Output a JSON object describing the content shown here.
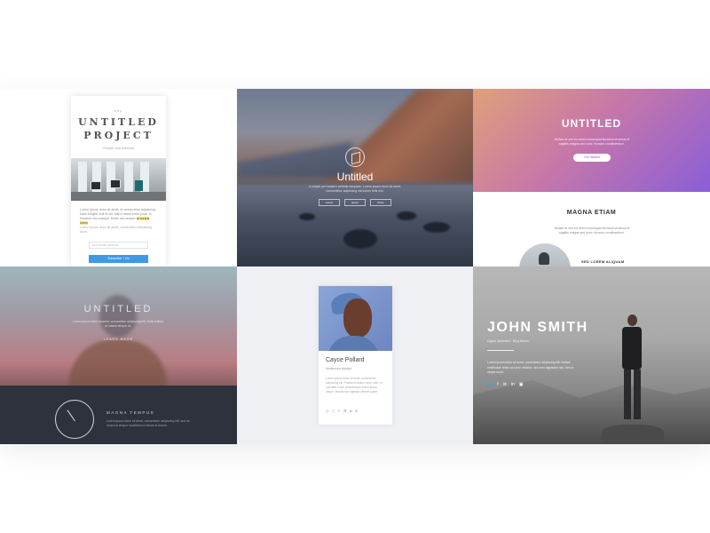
{
  "tiles": {
    "untitled_project": {
      "kicker": "hey",
      "title_line1": "UNTITLED",
      "title_line2": "PROJECT",
      "tagline": "Simple and minimal",
      "body": "Lorem ipsum dolor sit amet, et consectetur adipiscing. Nam fringilla velit et elit. Nam rutrum tortor justo, in tincidunt nisi suscipit. Morbi nec tempor",
      "highlight": "et cursus lorem",
      "body_tail": "Lorem ipsum dolor sit amet, consectetur adipiscing dolor.",
      "email_placeholder": "Your Email Address",
      "button_label": "Subscribe + Go"
    },
    "untitled_landscape": {
      "title": "Untitled",
      "subtitle": "A simple yet modern website template. Lorem ipsum dolor sit amet, consectetur adipiscing elit donec felis nisl.",
      "buttons": [
        "Lorem",
        "Ipsum",
        "Dolor"
      ]
    },
    "untitled_gradient": {
      "title": "UNTITLED",
      "subtitle": "Nullam et orci eu lorem consequat tincidunt vivamus et sagittis magna sed nunc rhoncus condimentum.",
      "button_label": "Get Started",
      "section_title": "MAGNA ETIAM",
      "section_subtitle": "Nullam et orci eu lorem consequat tincidunt vivamus et sagittis magna sed nunc rhoncus condimentum.",
      "caption": "SED LOREM ALIQUAM"
    },
    "untitled_overlay": {
      "title": "UNTITLED",
      "subtitle": "Lorem ipsum dolor sit amet, consectetur adipiscing elit. Nulla finibus at massa tempor et.",
      "more_label": "LEARN MORE",
      "feature_title": "MAGNA TEMPUS",
      "feature_text": "Lorem ipsum dolor sit amet, consectetur adipiscing elit, sed do eiusmod tempor incididunt ut labore et dolore."
    },
    "profile_card": {
      "name": "Cayce Pollard",
      "role": "Multimedia Analyst",
      "bio": "Lorem ipsum dolor sit amet, consectetur adipiscing elit. Praesent dictum tortor nibh, et convallis turpis pellentesque lorem ipsum neque. Mauris sed egestas ultrices quam.",
      "icons": [
        "◎",
        "▢",
        "✦",
        "⌘",
        "◈",
        "✉"
      ]
    },
    "john_smith": {
      "title": "JOHN SMITH",
      "subtitle": "Digital Specialist · Blog Maven",
      "body": "Lorem ipsum dolor sit amet, consectetur adipiscing elit. Nullam vestibulum tellus ac tortor efficitur, nec sem dignissim nisi. Sed in neque tortor.",
      "social": [
        "🐦",
        "f",
        "✉",
        "in",
        "▣"
      ]
    }
  }
}
